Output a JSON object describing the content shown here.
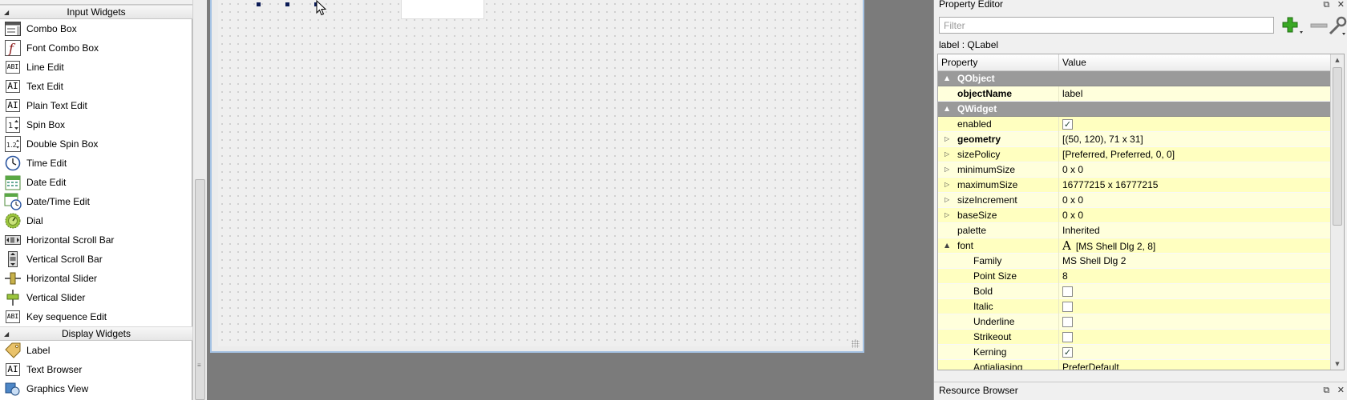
{
  "widget_box": {
    "categories": {
      "input": "Input Widgets",
      "display": "Display Widgets"
    },
    "input_items": [
      {
        "label": "Combo Box",
        "icon": "combo-box-icon"
      },
      {
        "label": "Font Combo Box",
        "icon": "font-combo-box-icon"
      },
      {
        "label": "Line Edit",
        "icon": "line-edit-icon"
      },
      {
        "label": "Text Edit",
        "icon": "text-edit-icon"
      },
      {
        "label": "Plain Text Edit",
        "icon": "plain-text-edit-icon"
      },
      {
        "label": "Spin Box",
        "icon": "spin-box-icon"
      },
      {
        "label": "Double Spin Box",
        "icon": "double-spin-box-icon"
      },
      {
        "label": "Time Edit",
        "icon": "clock-icon"
      },
      {
        "label": "Date Edit",
        "icon": "calendar-icon"
      },
      {
        "label": "Date/Time Edit",
        "icon": "calendar-clock-icon"
      },
      {
        "label": "Dial",
        "icon": "dial-icon"
      },
      {
        "label": "Horizontal Scroll Bar",
        "icon": "horizontal-scroll-bar-icon"
      },
      {
        "label": "Vertical Scroll Bar",
        "icon": "vertical-scroll-bar-icon"
      },
      {
        "label": "Horizontal Slider",
        "icon": "horizontal-slider-icon"
      },
      {
        "label": "Vertical Slider",
        "icon": "vertical-slider-icon"
      },
      {
        "label": "Key sequence Edit",
        "icon": "key-sequence-icon"
      }
    ],
    "display_items": [
      {
        "label": "Label",
        "icon": "label-tag-icon"
      },
      {
        "label": "Text Browser",
        "icon": "text-browser-icon"
      },
      {
        "label": "Graphics View",
        "icon": "graphics-view-icon"
      }
    ]
  },
  "property_editor": {
    "title": "Property Editor",
    "filter_placeholder": "Filter",
    "object_label": "label : QLabel",
    "columns": {
      "property": "Property",
      "value": "Value"
    },
    "rows": [
      {
        "kind": "section",
        "name": "QObject",
        "toggle": "▲"
      },
      {
        "kind": "prop",
        "name": "objectName",
        "value": "label",
        "bold": true
      },
      {
        "kind": "section",
        "name": "QWidget",
        "toggle": "▲"
      },
      {
        "kind": "prop",
        "name": "enabled",
        "check": true
      },
      {
        "kind": "prop",
        "name": "geometry",
        "value": "[(50, 120), 71 x 31]",
        "bold": true,
        "toggle": "▷"
      },
      {
        "kind": "prop",
        "name": "sizePolicy",
        "value": "[Preferred, Preferred, 0, 0]",
        "toggle": "▷"
      },
      {
        "kind": "prop",
        "name": "minimumSize",
        "value": "0 x 0",
        "toggle": "▷"
      },
      {
        "kind": "prop",
        "name": "maximumSize",
        "value": "16777215 x 16777215",
        "toggle": "▷"
      },
      {
        "kind": "prop",
        "name": "sizeIncrement",
        "value": "0 x 0",
        "toggle": "▷"
      },
      {
        "kind": "prop",
        "name": "baseSize",
        "value": "0 x 0",
        "toggle": "▷"
      },
      {
        "kind": "prop",
        "name": "palette",
        "value": "Inherited"
      },
      {
        "kind": "prop",
        "name": "font",
        "value": "[MS Shell Dlg 2, 8]",
        "toggle": "▲",
        "font_icon": "A"
      },
      {
        "kind": "sub",
        "name": "Family",
        "value": "MS Shell Dlg 2"
      },
      {
        "kind": "sub",
        "name": "Point Size",
        "value": "8"
      },
      {
        "kind": "sub",
        "name": "Bold",
        "check": false
      },
      {
        "kind": "sub",
        "name": "Italic",
        "check": false
      },
      {
        "kind": "sub",
        "name": "Underline",
        "check": false
      },
      {
        "kind": "sub",
        "name": "Strikeout",
        "check": false
      },
      {
        "kind": "sub",
        "name": "Kerning",
        "check": true
      },
      {
        "kind": "sub",
        "name": "Antialiasing",
        "value": "PreferDefault"
      }
    ]
  },
  "resource_browser": {
    "title": "Resource Browser"
  },
  "dock_buttons": {
    "float": "⧉",
    "close": "✕"
  },
  "colors": {
    "section_bg": "#9a9a9a",
    "row_odd": "#ffffdc",
    "row_even": "#ffffc0",
    "form_border": "#a4c2e3",
    "add_icon": "#2e9f1c"
  }
}
